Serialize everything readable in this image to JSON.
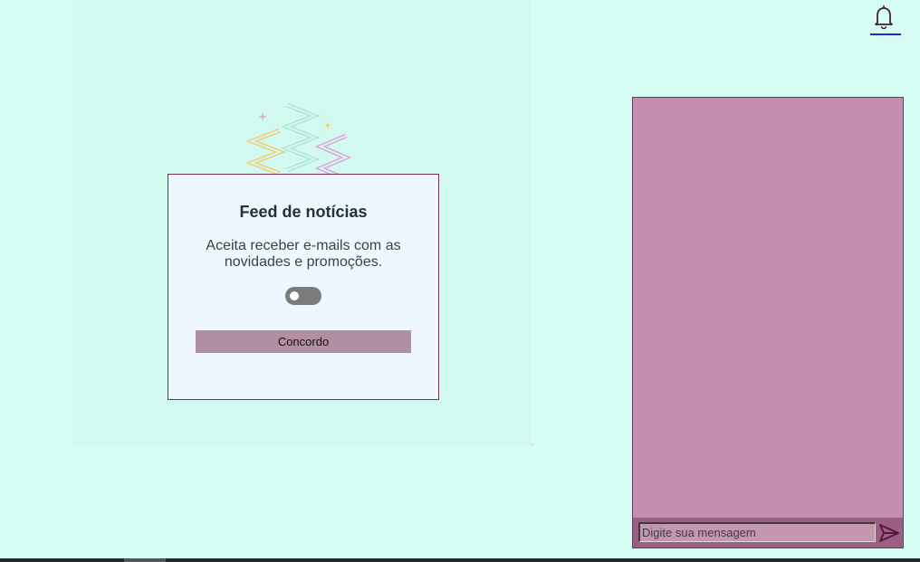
{
  "header": {
    "notifications_icon": "bell-icon"
  },
  "newsletter": {
    "title": "Feed de notícias",
    "text": "Aceita receber e-mails com as novidades e promoções.",
    "toggle_checked": false,
    "agree_label": "Concordo"
  },
  "chat": {
    "input_placeholder": "Digite sua mensagem",
    "input_value": "",
    "send_icon": "send-icon"
  },
  "colors": {
    "page_background": "#d6fdf3",
    "card_background": "#eef7fd",
    "card_border": "#7a2f58",
    "button_background": "#b28ea3",
    "chat_background": "#c48fae",
    "chat_footer": "#9b5f81",
    "toggle_off": "#7b7b7b",
    "confetti_yellow": "#efd07c",
    "confetti_mint": "#b2e6d8",
    "confetti_pink": "#e0a4dc"
  }
}
